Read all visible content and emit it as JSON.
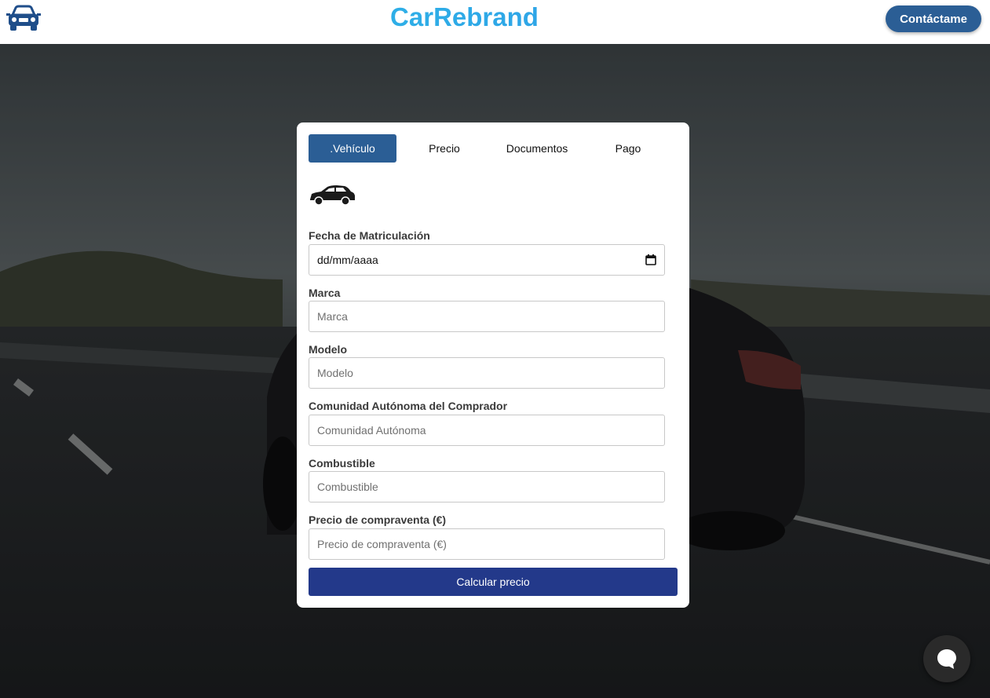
{
  "header": {
    "brand": "CarRebrand",
    "contact_label": "Contáctame",
    "logo_icon": "car-front-icon"
  },
  "form": {
    "tabs": [
      {
        "label": ".Vehículo",
        "active": true
      },
      {
        "label": "Precio",
        "active": false
      },
      {
        "label": "Documentos",
        "active": false
      },
      {
        "label": "Pago",
        "active": false
      }
    ],
    "vehicle_icon": "car-side-icon",
    "fields": [
      {
        "label": "Fecha de Matriculación",
        "value": "dd/mm/aaaa",
        "type": "date"
      },
      {
        "label": "Marca",
        "placeholder": "Marca"
      },
      {
        "label": "Modelo",
        "placeholder": "Modelo"
      },
      {
        "label": "Comunidad Autónoma del Comprador",
        "placeholder": "Comunidad Autónoma"
      },
      {
        "label": "Combustible",
        "placeholder": "Combustible"
      },
      {
        "label": "Precio de compraventa (€)",
        "placeholder": "Precio de compraventa (€)"
      }
    ],
    "submit_label": "Calcular precio"
  },
  "chat": {
    "icon": "chat-bubble-icon"
  },
  "colors": {
    "accent": "#2b5e95",
    "submit": "#23398a",
    "brand_start": "#2ec8e8",
    "brand_end": "#2f8ce6"
  }
}
